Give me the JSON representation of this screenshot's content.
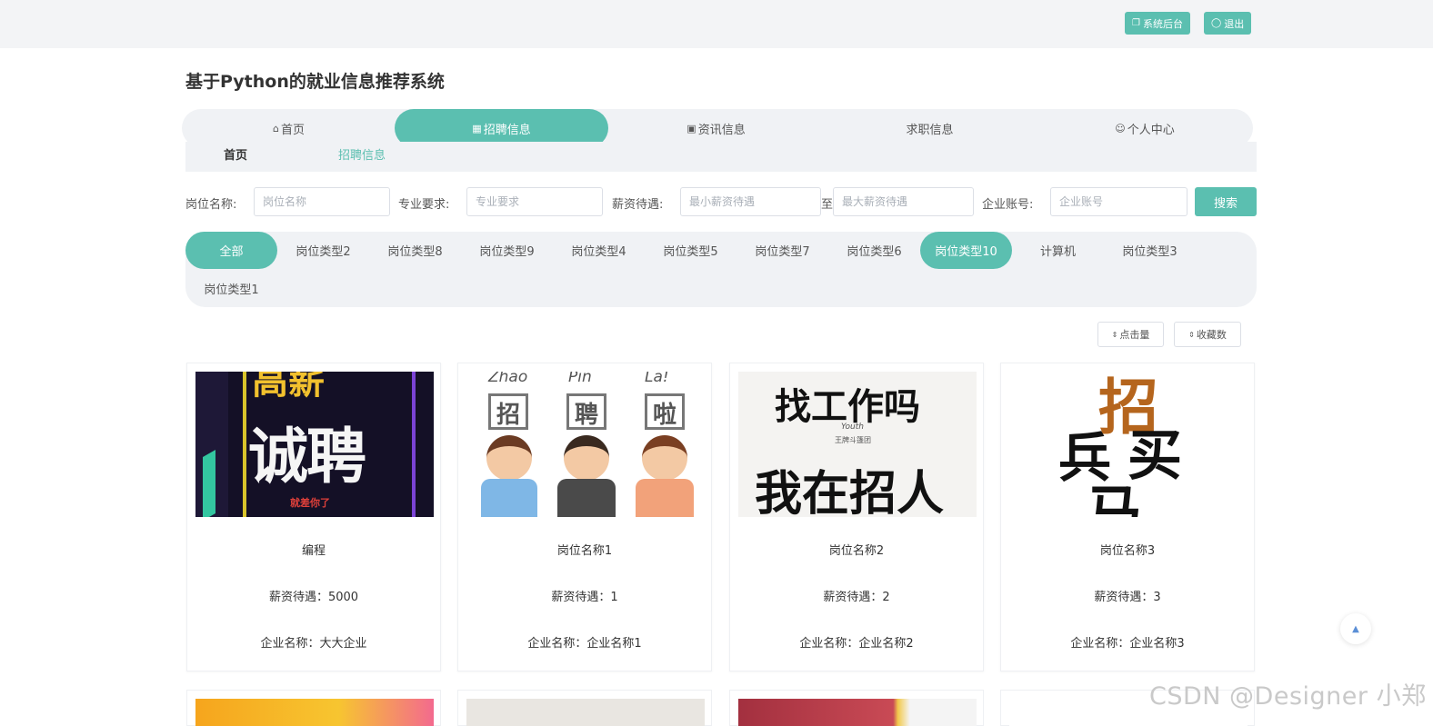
{
  "header": {
    "admin_label": "系统后台",
    "logout_label": "退出"
  },
  "site_title": "基于Python的就业信息推荐系统",
  "nav": [
    {
      "label": "首页",
      "icon": "home-icon",
      "active": false
    },
    {
      "label": "招聘信息",
      "icon": "grid-icon",
      "active": true
    },
    {
      "label": "资讯信息",
      "icon": "briefcase-icon",
      "active": false
    },
    {
      "label": "求职信息",
      "icon": "",
      "active": false
    },
    {
      "label": "个人中心",
      "icon": "user-icon",
      "active": false
    }
  ],
  "breadcrumb": {
    "home": "首页",
    "current": "招聘信息"
  },
  "filters": {
    "job_name_label": "岗位名称:",
    "job_name_placeholder": "岗位名称",
    "major_label": "专业要求:",
    "major_placeholder": "专业要求",
    "salary_label": "薪资待遇:",
    "salary_min_placeholder": "最小薪资待遇",
    "salary_to": "至",
    "salary_max_placeholder": "最大薪资待遇",
    "company_label": "企业账号:",
    "company_placeholder": "企业账号",
    "search_label": "搜索"
  },
  "categories": [
    "全部",
    "岗位类型2",
    "岗位类型8",
    "岗位类型9",
    "岗位类型4",
    "岗位类型5",
    "岗位类型7",
    "岗位类型6",
    "岗位类型10",
    "计算机",
    "岗位类型3",
    "岗位类型1"
  ],
  "active_categories": [
    "全部",
    "岗位类型10"
  ],
  "sort": {
    "clicks_label": "点击量",
    "favorites_label": "收藏数"
  },
  "cards": [
    {
      "title": "编程",
      "salary": "薪资待遇：5000",
      "company": "企业名称：大大企业",
      "poster": {
        "lines": [
          "高薪",
          "诚聘",
          "就差你了"
        ]
      }
    },
    {
      "title": "岗位名称1",
      "salary": "薪资待遇：1",
      "company": "企业名称：企业名称1",
      "poster": {
        "lines": [
          "Zhao",
          "Pin",
          "La!",
          "招",
          "聘",
          "啦"
        ]
      }
    },
    {
      "title": "岗位名称2",
      "salary": "薪资待遇：2",
      "company": "企业名称：企业名称2",
      "poster": {
        "lines": [
          "找工作吗",
          "Youth",
          "王牌斗篷团",
          "我在招人"
        ]
      }
    },
    {
      "title": "岗位名称3",
      "salary": "薪资待遇：3",
      "company": "企业名称：企业名称3",
      "poster": {
        "lines": [
          "招",
          "兵",
          "买",
          "马"
        ]
      }
    }
  ],
  "watermark": "CSDN @Designer 小郑",
  "colors": {
    "accent": "#5bbfb0",
    "panel": "#f0f2f5"
  }
}
